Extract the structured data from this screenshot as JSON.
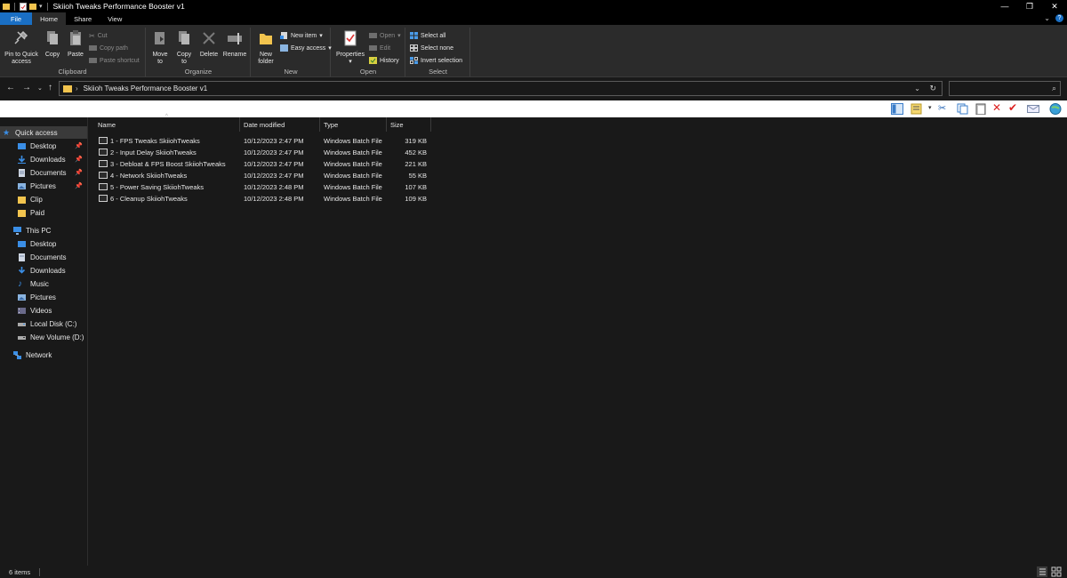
{
  "window": {
    "title": "Skiioh Tweaks Performance Booster v1",
    "minimize": "—",
    "maximize": "❐",
    "close": "✕"
  },
  "tabs": [
    {
      "label": "File"
    },
    {
      "label": "Home"
    },
    {
      "label": "Share"
    },
    {
      "label": "View"
    }
  ],
  "ribbon": {
    "clipboard": {
      "label": "Clipboard",
      "pin": "Pin to Quick access",
      "copy": "Copy",
      "paste": "Paste",
      "cut": "Cut",
      "copy_path": "Copy path",
      "paste_shortcut": "Paste shortcut"
    },
    "organize": {
      "label": "Organize",
      "move_to": "Move to",
      "copy_to": "Copy to",
      "delete": "Delete",
      "rename": "Rename"
    },
    "new": {
      "label": "New",
      "new_folder": "New folder",
      "new_item": "New item",
      "easy_access": "Easy access"
    },
    "open": {
      "label": "Open",
      "properties": "Properties",
      "open": "Open",
      "edit": "Edit",
      "history": "History"
    },
    "select": {
      "label": "Select",
      "select_all": "Select all",
      "select_none": "Select none",
      "invert_selection": "Invert selection"
    }
  },
  "address": {
    "path": "Skiioh Tweaks Performance Booster v1"
  },
  "sidebar": {
    "quick_access": "Quick access",
    "quick_items": [
      {
        "label": "Desktop"
      },
      {
        "label": "Downloads"
      },
      {
        "label": "Documents"
      },
      {
        "label": "Pictures"
      },
      {
        "label": "Clip"
      },
      {
        "label": "Paid"
      }
    ],
    "this_pc": "This PC",
    "pc_items": [
      {
        "label": "Desktop"
      },
      {
        "label": "Documents"
      },
      {
        "label": "Downloads"
      },
      {
        "label": "Music"
      },
      {
        "label": "Pictures"
      },
      {
        "label": "Videos"
      },
      {
        "label": "Local Disk (C:)"
      },
      {
        "label": "New Volume (D:)"
      }
    ],
    "network": "Network"
  },
  "columns": {
    "name": "Name",
    "date": "Date modified",
    "type": "Type",
    "size": "Size"
  },
  "files": [
    {
      "name": "1 - FPS Tweaks SkiiohTweaks",
      "date": "10/12/2023 2:47 PM",
      "type": "Windows Batch File",
      "size": "319 KB"
    },
    {
      "name": "2 - Input Delay SkiiohTweaks",
      "date": "10/12/2023 2:47 PM",
      "type": "Windows Batch File",
      "size": "452 KB"
    },
    {
      "name": "3 - Debloat & FPS Boost SkiiohTweaks",
      "date": "10/12/2023 2:47 PM",
      "type": "Windows Batch File",
      "size": "221 KB"
    },
    {
      "name": "4 - Network SkiiohTweaks",
      "date": "10/12/2023 2:47 PM",
      "type": "Windows Batch File",
      "size": "55 KB"
    },
    {
      "name": "5 - Power Saving SkiiohTweaks",
      "date": "10/12/2023 2:48 PM",
      "type": "Windows Batch File",
      "size": "107 KB"
    },
    {
      "name": "6 - Cleanup SkiiohTweaks",
      "date": "10/12/2023 2:48 PM",
      "type": "Windows Batch File",
      "size": "109 KB"
    }
  ],
  "status": {
    "count": "6 items"
  },
  "colors": {
    "accent": "#1a6fc4",
    "folder": "#f2c44e",
    "background": "#191919",
    "ribbon": "#2b2b2b"
  }
}
